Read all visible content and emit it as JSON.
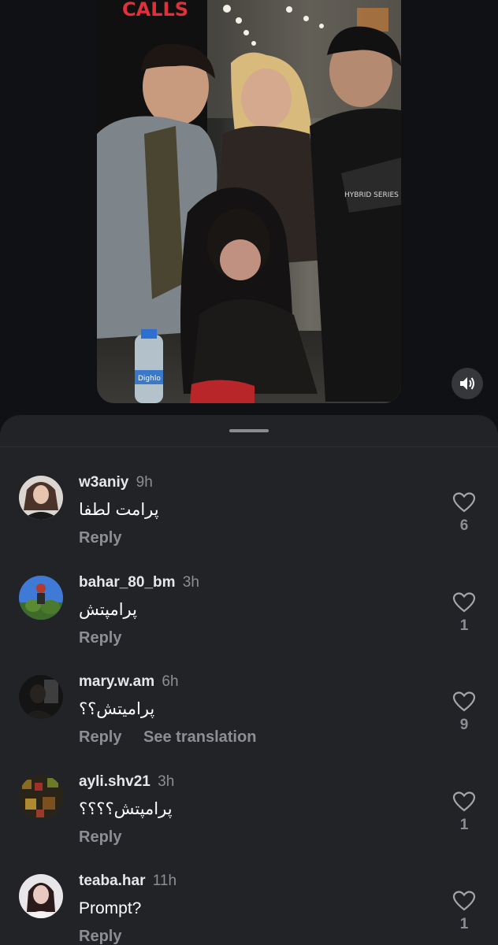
{
  "video": {
    "sign_text": "CALLS",
    "bottle_label": "Dighlo",
    "shirt_text": "HYBRID SERIES",
    "sound_icon": "speaker-on-icon"
  },
  "comments": [
    {
      "username": "w3aniy",
      "time": "9h",
      "text": "پرامت لطفا",
      "reply_label": "Reply",
      "likes": "6"
    },
    {
      "username": "bahar_80_bm",
      "time": "3h",
      "text": "پرامپتش",
      "reply_label": "Reply",
      "likes": "1"
    },
    {
      "username": "mary.w.am",
      "time": "6h",
      "text": "پرامیتش؟؟",
      "reply_label": "Reply",
      "translate_label": "See translation",
      "likes": "9"
    },
    {
      "username": "ayli.shv21",
      "time": "3h",
      "text": "پرامپتش؟؟؟؟",
      "reply_label": "Reply",
      "likes": "1"
    },
    {
      "username": "teaba.har",
      "time": "11h",
      "text": "Prompt?",
      "reply_label": "Reply",
      "likes": "1"
    }
  ],
  "colors": {
    "background": "#0f1114",
    "sheet": "#222327",
    "muted_text": "#8d8e93"
  }
}
